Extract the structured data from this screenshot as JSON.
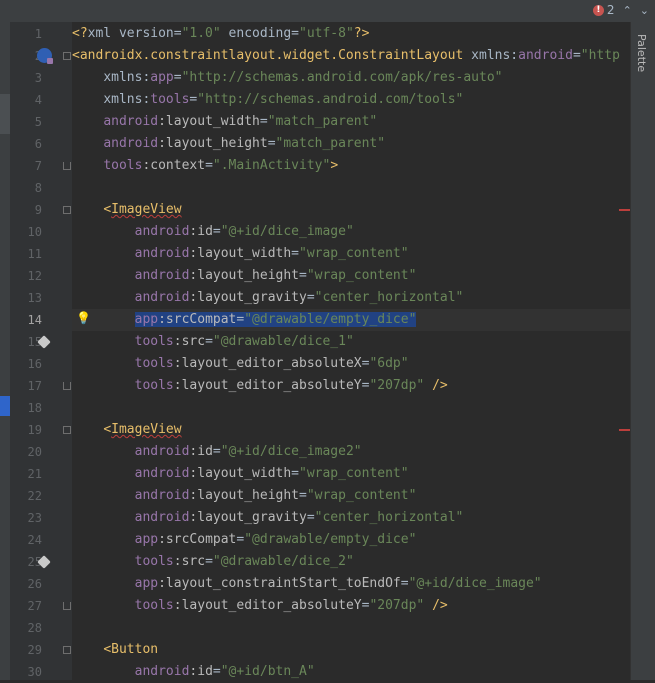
{
  "error_indicator": {
    "count": "2"
  },
  "right_panel": {
    "label": "Palette"
  },
  "current_line": 14,
  "lines": [
    {
      "n": "1",
      "indent": 0,
      "tokens": [
        {
          "t": "tag",
          "v": "<?"
        },
        {
          "t": "plain",
          "v": "xml version="
        },
        {
          "t": "val",
          "v": "\"1.0\""
        },
        {
          "t": "plain",
          "v": " encoding="
        },
        {
          "t": "val",
          "v": "\"utf-8\""
        },
        {
          "t": "tag",
          "v": "?>"
        }
      ]
    },
    {
      "n": "2",
      "indent": 0,
      "tokens": [
        {
          "t": "tag",
          "v": "<androidx.constraintlayout.widget.ConstraintLayout"
        },
        {
          "t": "plain",
          "v": " xmlns:"
        },
        {
          "t": "ns",
          "v": "android"
        },
        {
          "t": "plain",
          "v": "="
        },
        {
          "t": "val",
          "v": "\"http"
        }
      ]
    },
    {
      "n": "3",
      "indent": 1,
      "tokens": [
        {
          "t": "plain",
          "v": "xmlns:"
        },
        {
          "t": "ns",
          "v": "app"
        },
        {
          "t": "plain",
          "v": "="
        },
        {
          "t": "val",
          "v": "\"http://schemas.android.com/apk/res-auto\""
        }
      ]
    },
    {
      "n": "4",
      "indent": 1,
      "tokens": [
        {
          "t": "plain",
          "v": "xmlns:"
        },
        {
          "t": "ns",
          "v": "tools"
        },
        {
          "t": "plain",
          "v": "="
        },
        {
          "t": "val",
          "v": "\"http://schemas.android.com/tools\""
        }
      ]
    },
    {
      "n": "5",
      "indent": 1,
      "tokens": [
        {
          "t": "ns",
          "v": "android"
        },
        {
          "t": "attr",
          "v": ":layout_width"
        },
        {
          "t": "plain",
          "v": "="
        },
        {
          "t": "val",
          "v": "\"match_parent\""
        }
      ]
    },
    {
      "n": "6",
      "indent": 1,
      "tokens": [
        {
          "t": "ns",
          "v": "android"
        },
        {
          "t": "attr",
          "v": ":layout_height"
        },
        {
          "t": "plain",
          "v": "="
        },
        {
          "t": "val",
          "v": "\"match_parent\""
        }
      ]
    },
    {
      "n": "7",
      "indent": 1,
      "tokens": [
        {
          "t": "ns",
          "v": "tools"
        },
        {
          "t": "attr",
          "v": ":context"
        },
        {
          "t": "plain",
          "v": "="
        },
        {
          "t": "val",
          "v": "\".MainActivity\""
        },
        {
          "t": "tag",
          "v": ">"
        }
      ]
    },
    {
      "n": "8",
      "indent": 0,
      "tokens": []
    },
    {
      "n": "9",
      "indent": 1,
      "tokens": [
        {
          "t": "tag",
          "v": "<"
        },
        {
          "t": "tag-sq",
          "v": "ImageView"
        }
      ]
    },
    {
      "n": "10",
      "indent": 2,
      "tokens": [
        {
          "t": "ns",
          "v": "android"
        },
        {
          "t": "attr",
          "v": ":id"
        },
        {
          "t": "plain",
          "v": "="
        },
        {
          "t": "val",
          "v": "\"@+id/dice_image\""
        }
      ]
    },
    {
      "n": "11",
      "indent": 2,
      "tokens": [
        {
          "t": "ns",
          "v": "android"
        },
        {
          "t": "attr",
          "v": ":layout_width"
        },
        {
          "t": "plain",
          "v": "="
        },
        {
          "t": "val",
          "v": "\"wrap_content\""
        }
      ]
    },
    {
      "n": "12",
      "indent": 2,
      "tokens": [
        {
          "t": "ns",
          "v": "android"
        },
        {
          "t": "attr",
          "v": ":layout_height"
        },
        {
          "t": "plain",
          "v": "="
        },
        {
          "t": "val",
          "v": "\"wrap_content\""
        }
      ]
    },
    {
      "n": "13",
      "indent": 2,
      "tokens": [
        {
          "t": "ns",
          "v": "android"
        },
        {
          "t": "attr",
          "v": ":layout_gravity"
        },
        {
          "t": "plain",
          "v": "="
        },
        {
          "t": "val",
          "v": "\"center_horizontal\""
        }
      ]
    },
    {
      "n": "14",
      "indent": 2,
      "selected": true,
      "tokens": [
        {
          "t": "ns",
          "v": "app"
        },
        {
          "t": "attr",
          "v": ":srcCompat"
        },
        {
          "t": "plain",
          "v": "="
        },
        {
          "t": "val",
          "v": "\"@drawable/empty_dice\""
        }
      ]
    },
    {
      "n": "15",
      "indent": 2,
      "tokens": [
        {
          "t": "ns",
          "v": "tools"
        },
        {
          "t": "attr",
          "v": ":src"
        },
        {
          "t": "plain",
          "v": "="
        },
        {
          "t": "val",
          "v": "\"@drawable/dice_1\""
        }
      ]
    },
    {
      "n": "16",
      "indent": 2,
      "tokens": [
        {
          "t": "ns",
          "v": "tools"
        },
        {
          "t": "attr",
          "v": ":layout_editor_absoluteX"
        },
        {
          "t": "plain",
          "v": "="
        },
        {
          "t": "val",
          "v": "\"6dp\""
        }
      ]
    },
    {
      "n": "17",
      "indent": 2,
      "tokens": [
        {
          "t": "ns",
          "v": "tools"
        },
        {
          "t": "attr",
          "v": ":layout_editor_absoluteY"
        },
        {
          "t": "plain",
          "v": "="
        },
        {
          "t": "val",
          "v": "\"207dp\""
        },
        {
          "t": "plain",
          "v": " "
        },
        {
          "t": "tag",
          "v": "/>"
        }
      ]
    },
    {
      "n": "18",
      "indent": 0,
      "tokens": []
    },
    {
      "n": "19",
      "indent": 1,
      "tokens": [
        {
          "t": "tag",
          "v": "<"
        },
        {
          "t": "tag-sq",
          "v": "ImageView"
        }
      ]
    },
    {
      "n": "20",
      "indent": 2,
      "tokens": [
        {
          "t": "ns",
          "v": "android"
        },
        {
          "t": "attr",
          "v": ":id"
        },
        {
          "t": "plain",
          "v": "="
        },
        {
          "t": "val",
          "v": "\"@+id/dice_image2\""
        }
      ]
    },
    {
      "n": "21",
      "indent": 2,
      "tokens": [
        {
          "t": "ns",
          "v": "android"
        },
        {
          "t": "attr",
          "v": ":layout_width"
        },
        {
          "t": "plain",
          "v": "="
        },
        {
          "t": "val",
          "v": "\"wrap_content\""
        }
      ]
    },
    {
      "n": "22",
      "indent": 2,
      "tokens": [
        {
          "t": "ns",
          "v": "android"
        },
        {
          "t": "attr",
          "v": ":layout_height"
        },
        {
          "t": "plain",
          "v": "="
        },
        {
          "t": "val",
          "v": "\"wrap_content\""
        }
      ]
    },
    {
      "n": "23",
      "indent": 2,
      "tokens": [
        {
          "t": "ns",
          "v": "android"
        },
        {
          "t": "attr",
          "v": ":layout_gravity"
        },
        {
          "t": "plain",
          "v": "="
        },
        {
          "t": "val",
          "v": "\"center_horizontal\""
        }
      ]
    },
    {
      "n": "24",
      "indent": 2,
      "tokens": [
        {
          "t": "ns",
          "v": "app"
        },
        {
          "t": "attr",
          "v": ":srcCompat"
        },
        {
          "t": "plain",
          "v": "="
        },
        {
          "t": "val",
          "v": "\"@drawable/empty_dice\""
        }
      ]
    },
    {
      "n": "25",
      "indent": 2,
      "tokens": [
        {
          "t": "ns",
          "v": "tools"
        },
        {
          "t": "attr",
          "v": ":src"
        },
        {
          "t": "plain",
          "v": "="
        },
        {
          "t": "val",
          "v": "\"@drawable/dice_2\""
        }
      ]
    },
    {
      "n": "26",
      "indent": 2,
      "tokens": [
        {
          "t": "ns",
          "v": "app"
        },
        {
          "t": "attr",
          "v": ":layout_constraintStart_toEndOf"
        },
        {
          "t": "plain",
          "v": "="
        },
        {
          "t": "val",
          "v": "\"@+id/dice_image\""
        }
      ]
    },
    {
      "n": "27",
      "indent": 2,
      "tokens": [
        {
          "t": "ns",
          "v": "tools"
        },
        {
          "t": "attr",
          "v": ":layout_editor_absoluteY"
        },
        {
          "t": "plain",
          "v": "="
        },
        {
          "t": "val",
          "v": "\"207dp\""
        },
        {
          "t": "plain",
          "v": " "
        },
        {
          "t": "tag",
          "v": "/>"
        }
      ]
    },
    {
      "n": "28",
      "indent": 0,
      "tokens": []
    },
    {
      "n": "29",
      "indent": 1,
      "tokens": [
        {
          "t": "tag",
          "v": "<Button"
        }
      ]
    },
    {
      "n": "30",
      "indent": 2,
      "tokens": [
        {
          "t": "ns",
          "v": "android"
        },
        {
          "t": "attr",
          "v": ":id"
        },
        {
          "t": "plain",
          "v": "="
        },
        {
          "t": "val",
          "v": "\"@+id/btn_A\""
        }
      ]
    }
  ],
  "gutter_icons": [
    {
      "line": 2,
      "icon": "constraint-layout-icon"
    },
    {
      "line": 14,
      "icon": "lightbulb-icon"
    },
    {
      "line": 15,
      "icon": "image-preview-icon"
    },
    {
      "line": 25,
      "icon": "image-preview-icon"
    }
  ],
  "colors": {
    "background": "#2b2b2b",
    "tag": "#e8bf6a",
    "namespace": "#9876aa",
    "string": "#6a8759",
    "selection": "#214283",
    "error": "#bc3f3c"
  }
}
